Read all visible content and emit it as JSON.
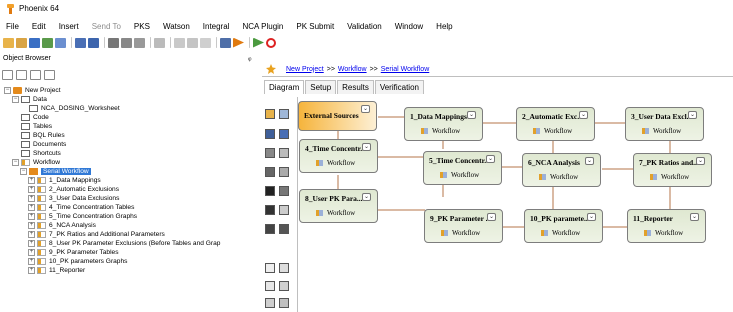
{
  "window": {
    "title": "Phoenix 64"
  },
  "menu": {
    "items": [
      {
        "label": "File",
        "enabled": true
      },
      {
        "label": "Edit",
        "enabled": true
      },
      {
        "label": "Insert",
        "enabled": true
      },
      {
        "label": "Send To",
        "enabled": false
      },
      {
        "label": "PKS",
        "enabled": true
      },
      {
        "label": "Watson",
        "enabled": true
      },
      {
        "label": "Integral",
        "enabled": true
      },
      {
        "label": "NCA Plugin",
        "enabled": true
      },
      {
        "label": "PK Submit",
        "enabled": true
      },
      {
        "label": "Validation",
        "enabled": true
      },
      {
        "label": "Window",
        "enabled": true
      },
      {
        "label": "Help",
        "enabled": true
      }
    ]
  },
  "object_browser": {
    "title": "Object Browser",
    "pin": "ᵩ",
    "tree": [
      {
        "label": "New Project",
        "type": "proj"
      },
      {
        "label": "Data",
        "type": "folder"
      },
      {
        "label": "NCA_DOSING_Worksheet",
        "type": "folder"
      },
      {
        "label": "Code",
        "type": "folder"
      },
      {
        "label": "Tables",
        "type": "folder"
      },
      {
        "label": "BQL Rules",
        "type": "folder"
      },
      {
        "label": "Documents",
        "type": "folder"
      },
      {
        "label": "Shortcuts",
        "type": "folder"
      },
      {
        "label": "Workflow",
        "type": "wf"
      },
      {
        "label": "Serial Workflow",
        "type": "wf"
      },
      {
        "label": "1_Data Mappings",
        "type": "wf"
      },
      {
        "label": "2_Automatic Exclusions",
        "type": "wf"
      },
      {
        "label": "3_User Data Exclusions",
        "type": "wf"
      },
      {
        "label": "4_Time Concentration Tables",
        "type": "wf"
      },
      {
        "label": "5_Time Concentration Graphs",
        "type": "wf"
      },
      {
        "label": "6_NCA Analysis",
        "type": "wf"
      },
      {
        "label": "7_PK Ratios and Additional Parameters",
        "type": "wf"
      },
      {
        "label": "8_User PK Parameter Exclusions (Before Tables and Grap",
        "type": "wf"
      },
      {
        "label": "9_PK Parameter Tables",
        "type": "wf"
      },
      {
        "label": "10_PK parameters Graphs",
        "type": "wf"
      },
      {
        "label": "11_Reporter",
        "type": "wf"
      }
    ]
  },
  "breadcrumb": [
    "New Project",
    "Workflow",
    "Serial Workflow"
  ],
  "breadcrumb_sep": ">>",
  "tabs": [
    "Diagram",
    "Setup",
    "Results",
    "Verification"
  ],
  "diagram": {
    "workflow_label": "Workflow",
    "chevron": "⌄",
    "nodes": [
      {
        "id": "ext",
        "title": "External Sources"
      },
      {
        "id": "n1",
        "title": "1_Data Mappings"
      },
      {
        "id": "n2",
        "title": "2_Automatic Exc..."
      },
      {
        "id": "n3",
        "title": "3_User Data Excl..."
      },
      {
        "id": "n4",
        "title": "4_Time Concentr..."
      },
      {
        "id": "n5",
        "title": "5_Time Concentr..."
      },
      {
        "id": "n6",
        "title": "6_NCA Analysis"
      },
      {
        "id": "n7",
        "title": "7_PK Ratios and..."
      },
      {
        "id": "n8",
        "title": "8_User PK Para..."
      },
      {
        "id": "n9",
        "title": "9_PK Parameter ..."
      },
      {
        "id": "n10",
        "title": "10_PK paramete..."
      },
      {
        "id": "n11",
        "title": "11_Reporter"
      }
    ]
  }
}
